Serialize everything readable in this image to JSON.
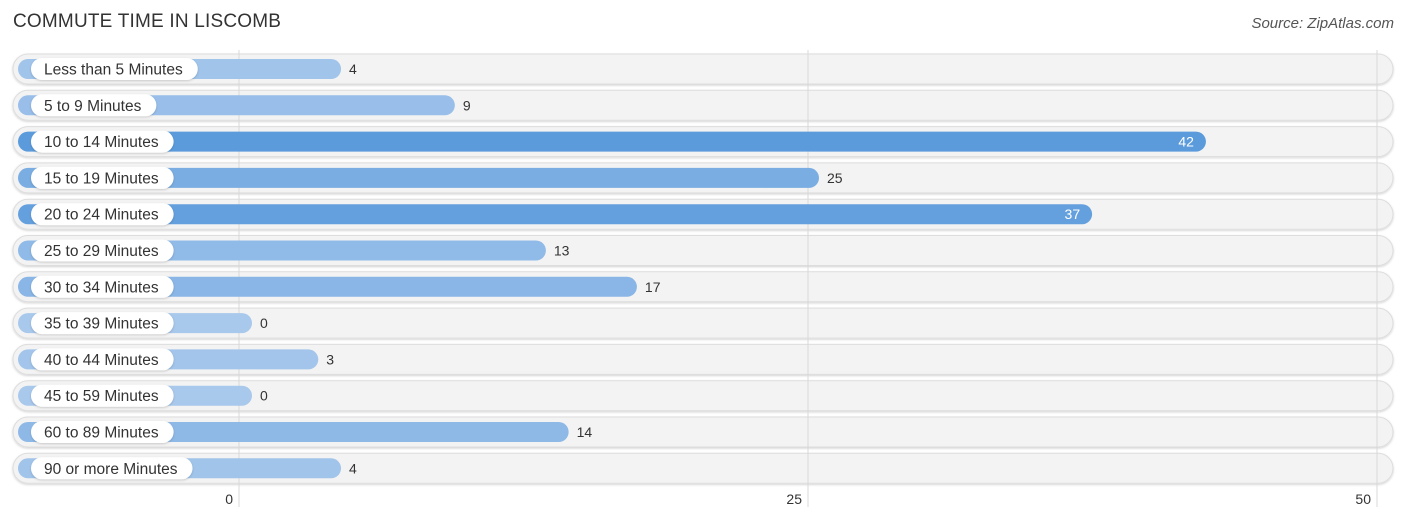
{
  "chart_data": {
    "type": "bar",
    "orientation": "horizontal",
    "title": "COMMUTE TIME IN LISCOMB",
    "source": "Source: ZipAtlas.com",
    "categories": [
      "Less than 5 Minutes",
      "5 to 9 Minutes",
      "10 to 14 Minutes",
      "15 to 19 Minutes",
      "20 to 24 Minutes",
      "25 to 29 Minutes",
      "30 to 34 Minutes",
      "35 to 39 Minutes",
      "40 to 44 Minutes",
      "45 to 59 Minutes",
      "60 to 89 Minutes",
      "90 or more Minutes"
    ],
    "values": [
      4,
      9,
      42,
      25,
      37,
      13,
      17,
      0,
      3,
      0,
      14,
      4
    ],
    "xlim": [
      0,
      50
    ],
    "xticks": [
      "0",
      "25",
      "50"
    ],
    "xlabel": "",
    "ylabel": "",
    "grid": true,
    "colors": {
      "bar_low": "#a8c8ec",
      "bar_high": "#5b9bdc",
      "track": "#f3f3f3"
    }
  }
}
